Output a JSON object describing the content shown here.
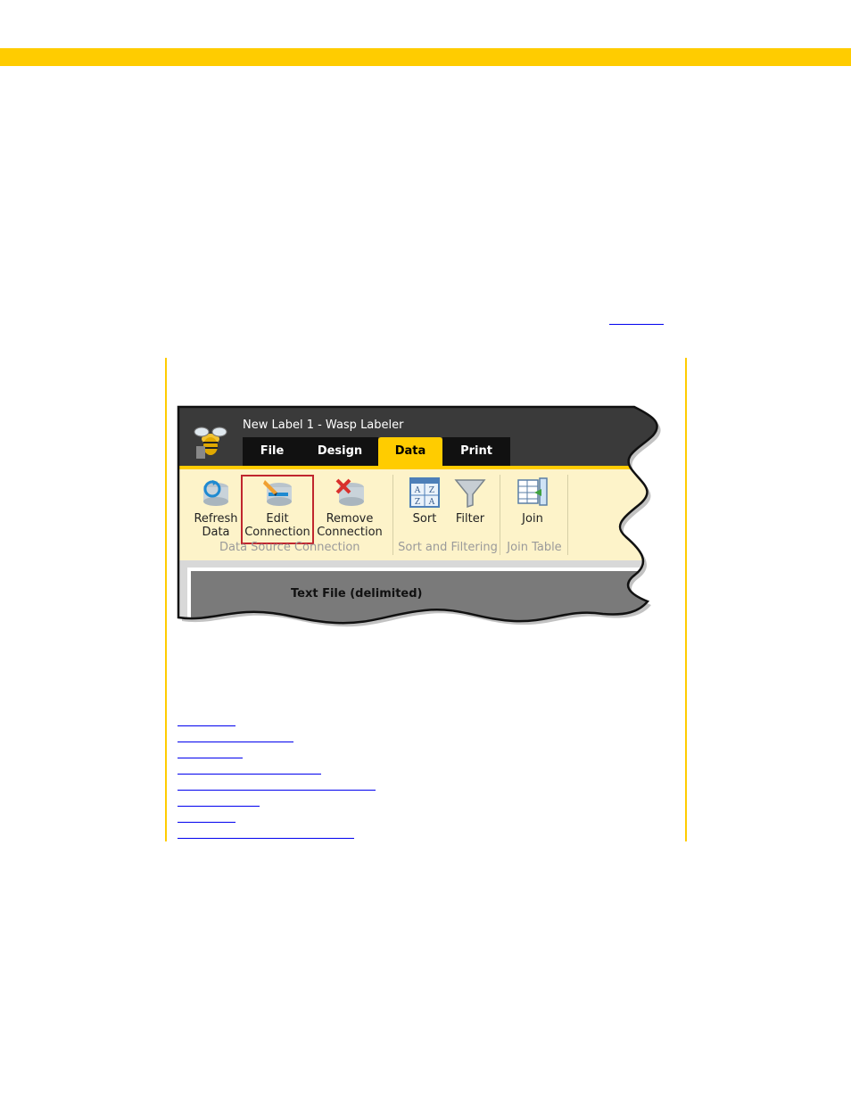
{
  "colors": {
    "accent": "#ffcc00",
    "link": "#0000ee",
    "highlight": "#c0262e"
  },
  "app": {
    "window_title": "New Label 1 - Wasp Labeler",
    "tabs": [
      {
        "label": "File",
        "active": false
      },
      {
        "label": "Design",
        "active": false
      },
      {
        "label": "Data",
        "active": true
      },
      {
        "label": "Print",
        "active": false
      }
    ],
    "ribbon": {
      "buttons": [
        {
          "line1": "Refresh",
          "line2": "Data",
          "icon": "refresh-data-icon"
        },
        {
          "line1": "Edit",
          "line2": "Connection",
          "icon": "edit-connection-icon",
          "highlighted": true
        },
        {
          "line1": "Remove",
          "line2": "Connection",
          "icon": "remove-connection-icon"
        },
        {
          "line1": "Sort",
          "line2": "",
          "icon": "sort-icon"
        },
        {
          "line1": "Filter",
          "line2": "",
          "icon": "filter-icon"
        },
        {
          "line1": "Join",
          "line2": "",
          "icon": "join-table-icon"
        }
      ],
      "groups": [
        {
          "label": "Data Source Connection"
        },
        {
          "label": "Sort and Filtering"
        },
        {
          "label": "Join Table"
        }
      ]
    },
    "document_pane_text": "Text File (delimited)"
  }
}
